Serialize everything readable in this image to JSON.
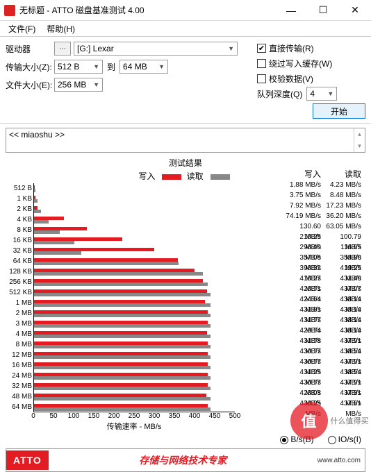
{
  "window": {
    "title": "无标题 - ATTO 磁盘基准测试 4.00",
    "menu": {
      "file": "文件(F)",
      "help": "帮助(H)"
    }
  },
  "toolbar": {
    "drive_label": "驱动器",
    "drive_value": "[G:] Lexar",
    "transfer_label": "传输大小(Z):",
    "transfer_from": "512 B",
    "to_label": "到",
    "transfer_to": "64 MB",
    "filesize_label": "文件大小(E):",
    "filesize_value": "256 MB",
    "direct_io": "直接传输(R)",
    "bypass_cache": "绕过写入缓存(W)",
    "verify": "校验数据(V)",
    "queue_label": "队列深度(Q)",
    "queue_value": "4",
    "start": "开始"
  },
  "desc": {
    "text": "<< miaoshu >>"
  },
  "chart": {
    "title": "测试结果",
    "legend_write": "写入",
    "legend_read": "读取",
    "xlabel": "传输速率 - MB/s",
    "hdr_write": "写入",
    "hdr_read": "读取"
  },
  "unit": {
    "bps": "B/s(B)",
    "iops": "IO/s(I)"
  },
  "footer": {
    "logo": "ATTO",
    "text": "存储与网络技术专家",
    "url": "www.atto.com"
  },
  "watermark": {
    "char": "值",
    "text": "什么值得买"
  },
  "chart_data": {
    "type": "bar",
    "xlabel": "传输速率 - MB/s",
    "xlim": [
      0,
      500
    ],
    "xticks": [
      0,
      50,
      100,
      150,
      200,
      250,
      300,
      350,
      400,
      450,
      500
    ],
    "unit": "MB/s",
    "categories": [
      "512 B",
      "1 KB",
      "2 KB",
      "4 KB",
      "8 KB",
      "16 KB",
      "32 KB",
      "64 KB",
      "128 KB",
      "256 KB",
      "512 KB",
      "1 MB",
      "2 MB",
      "3 MB",
      "4 MB",
      "8 MB",
      "12 MB",
      "16 MB",
      "24 MB",
      "32 MB",
      "48 MB",
      "64 MB"
    ],
    "series": [
      {
        "name": "写入",
        "color": "#e31b23",
        "values": [
          1.88,
          3.75,
          7.92,
          74.19,
          130.6,
          218.25,
          298.4,
          357.06,
          398.32,
          418.27,
          428.71,
          424.64,
          431.81,
          431.77,
          429.74,
          431.78,
          430.77,
          430.77,
          431.25,
          430.77,
          428.03,
          430.25
        ]
      },
      {
        "name": "读取",
        "color": "#888888",
        "values": [
          4.23,
          8.48,
          17.23,
          36.2,
          63.05,
          100.79,
          116.65,
          358.8,
          419.25,
          431.4,
          437.07,
          438.14,
          438.14,
          438.14,
          438.14,
          437.91,
          438.54,
          437.91,
          438.54,
          437.91,
          437.31,
          437.61
        ]
      }
    ]
  }
}
